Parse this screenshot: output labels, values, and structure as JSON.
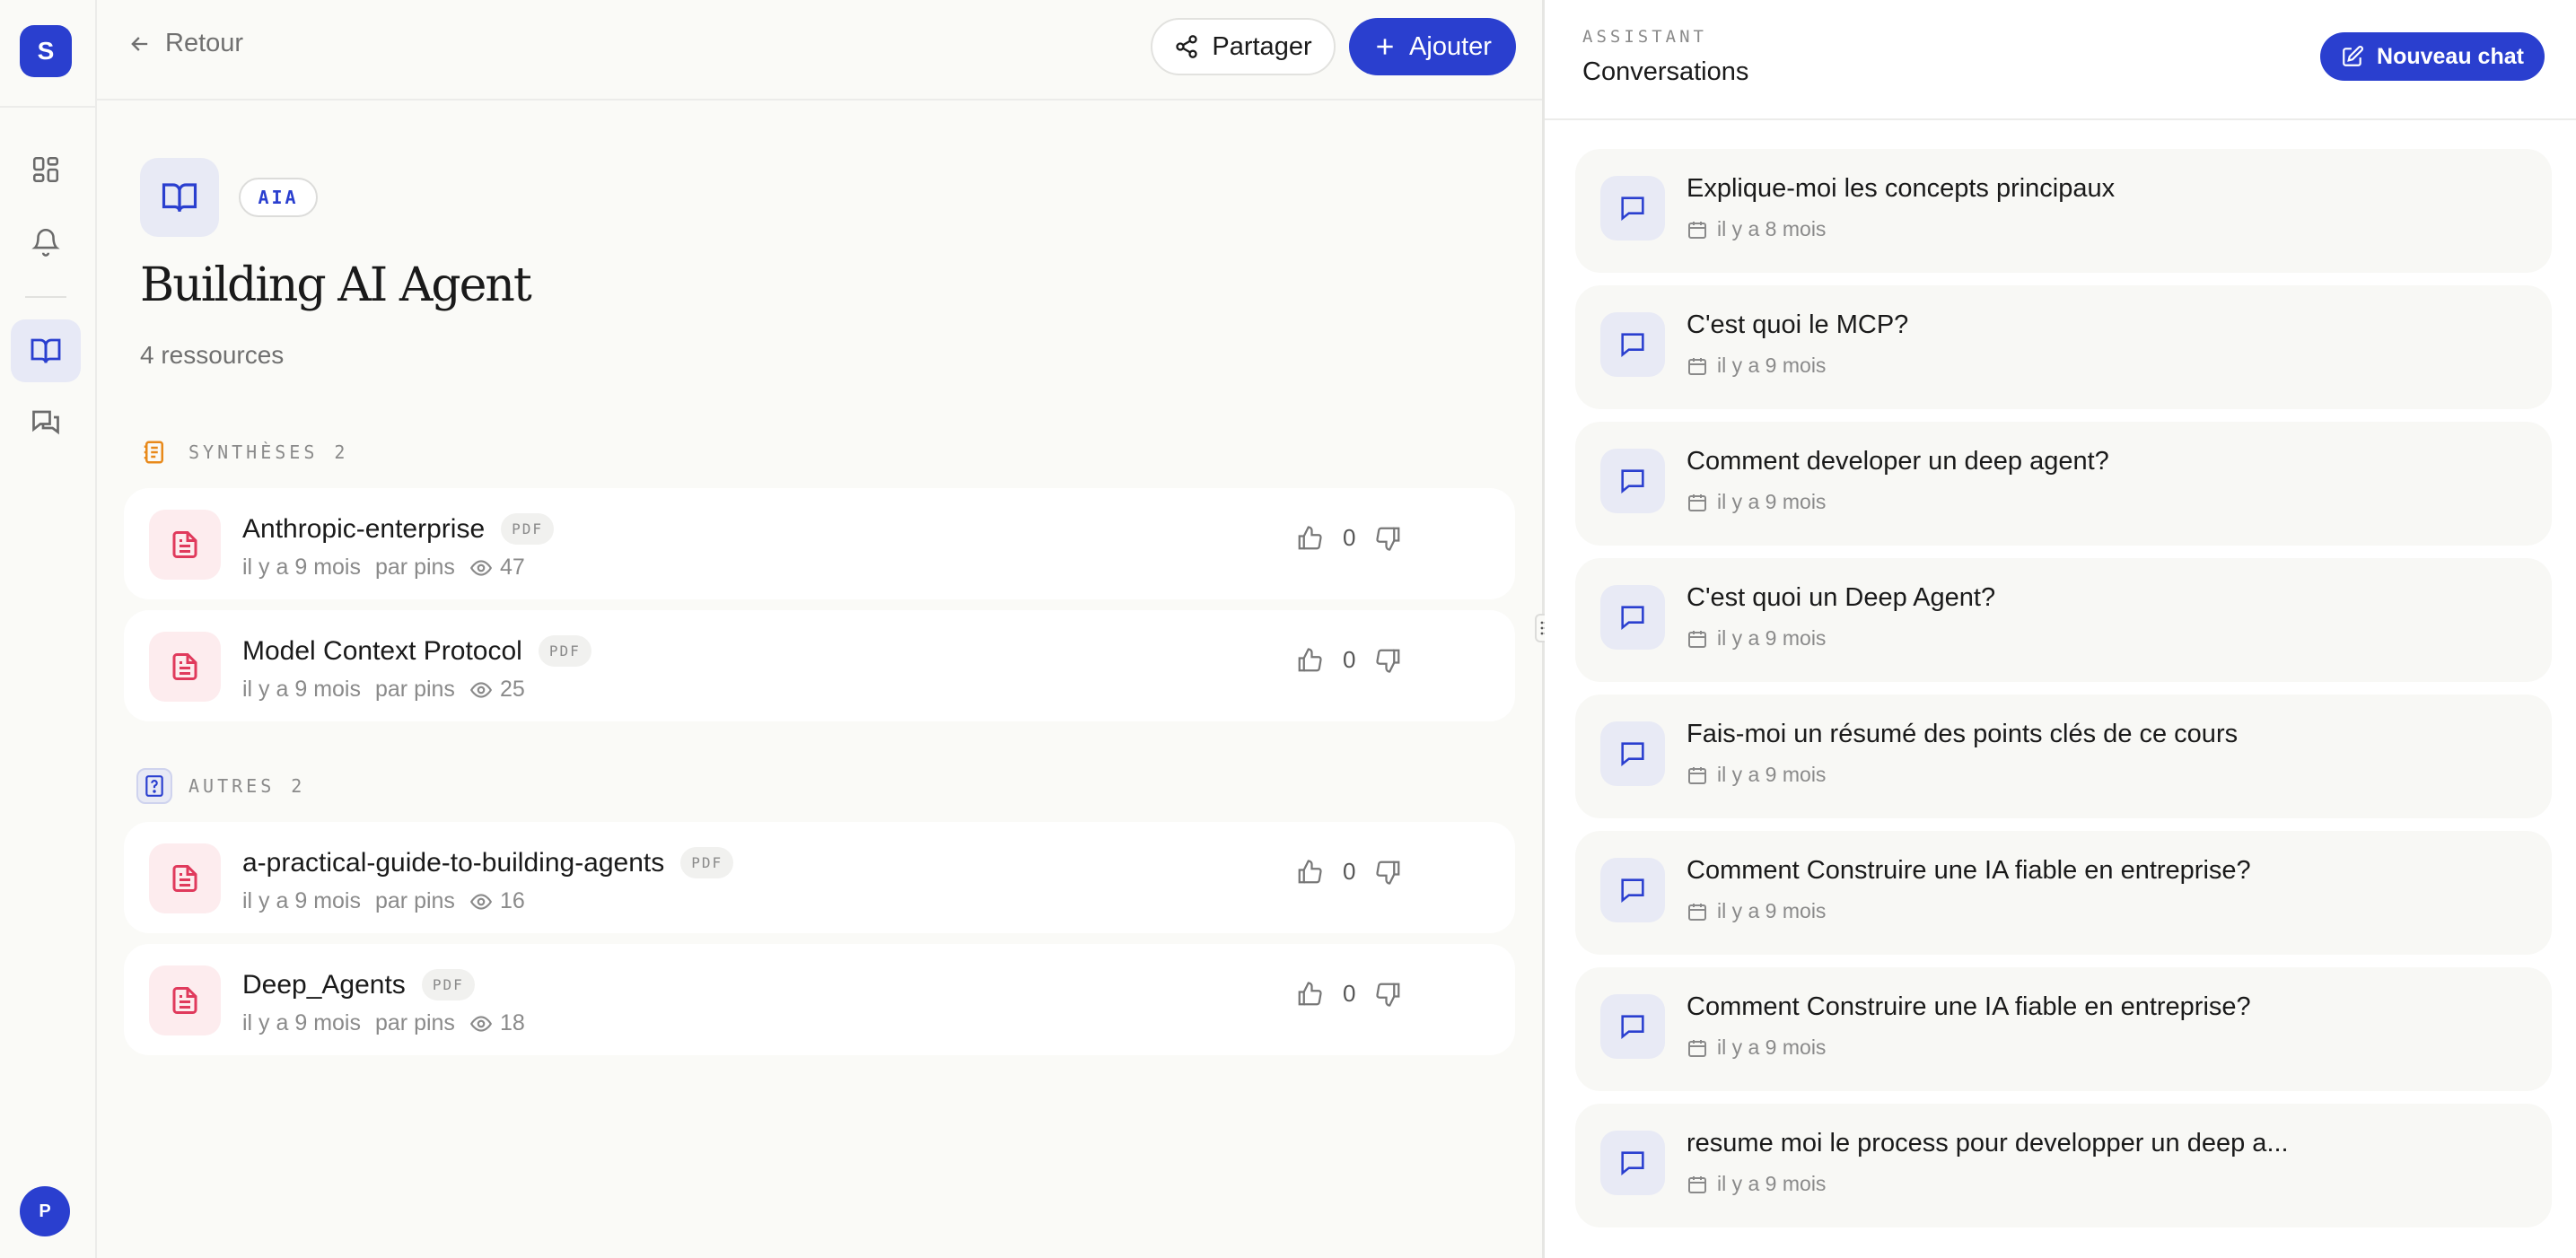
{
  "rail": {
    "logo_letter": "S",
    "avatar_letter": "P"
  },
  "toolbar": {
    "back_label": "Retour",
    "share_label": "Partager",
    "add_label": "Ajouter"
  },
  "collection": {
    "tag": "AIA",
    "title": "Building AI Agent",
    "count": "4 ressources"
  },
  "sections": [
    {
      "label": "SYNTHÈSES",
      "count": "2",
      "items": [
        {
          "name": "Anthropic-enterprise",
          "badge": "PDF",
          "date": "il y a 9 mois",
          "author": "par pins",
          "views": "47",
          "votes": "0"
        },
        {
          "name": "Model Context Protocol",
          "badge": "PDF",
          "date": "il y a 9 mois",
          "author": "par pins",
          "views": "25",
          "votes": "0"
        }
      ]
    },
    {
      "label": "AUTRES",
      "count": "2",
      "items": [
        {
          "name": "a-practical-guide-to-building-agents",
          "badge": "PDF",
          "date": "il y a 9 mois",
          "author": "par pins",
          "views": "16",
          "votes": "0"
        },
        {
          "name": "Deep_Agents",
          "badge": "PDF",
          "date": "il y a 9 mois",
          "author": "par pins",
          "views": "18",
          "votes": "0"
        }
      ]
    }
  ],
  "assistant": {
    "label": "ASSISTANT",
    "title": "Conversations",
    "new_chat_label": "Nouveau chat",
    "conversations": [
      {
        "title": "Explique-moi les concepts principaux",
        "date": "il y a 8 mois"
      },
      {
        "title": "C'est quoi le MCP?",
        "date": "il y a 9 mois"
      },
      {
        "title": "Comment developer un deep agent?",
        "date": "il y a 9 mois"
      },
      {
        "title": "C'est quoi un Deep Agent?",
        "date": "il y a 9 mois"
      },
      {
        "title": "Fais-moi un résumé des points clés de ce cours",
        "date": "il y a 9 mois"
      },
      {
        "title": "Comment Construire une IA fiable en entreprise?",
        "date": "il y a 9 mois"
      },
      {
        "title": "Comment Construire une IA fiable en entreprise?",
        "date": "il y a 9 mois"
      },
      {
        "title": "resume moi le process pour developper un deep a...",
        "date": "il y a 9 mois"
      }
    ]
  },
  "colors": {
    "accent": "#2a3fcf",
    "file_icon": "#e03a5c",
    "synth_icon": "#e8891a"
  }
}
